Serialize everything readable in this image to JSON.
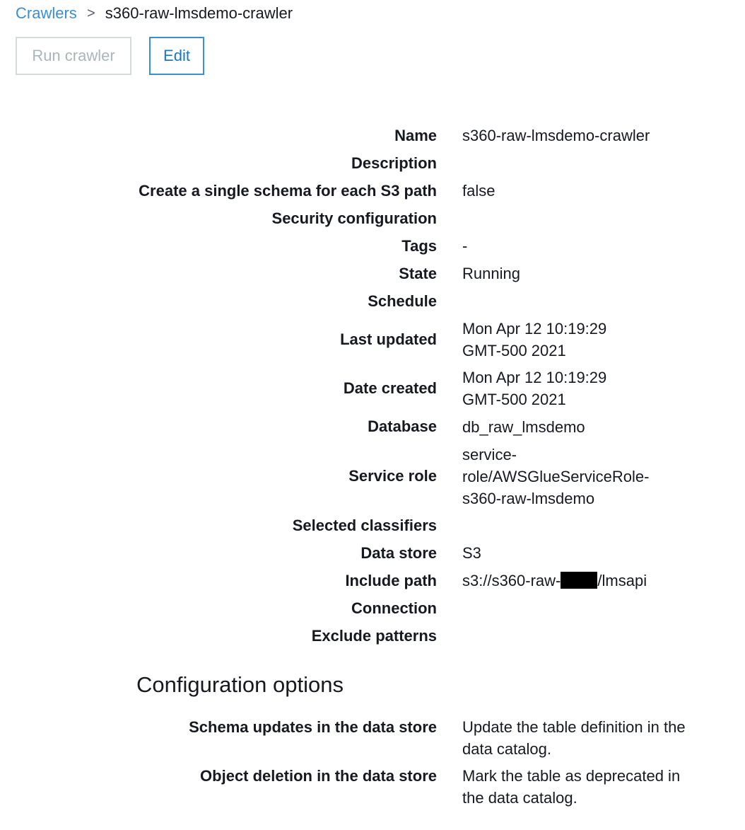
{
  "breadcrumb": {
    "parent": "Crawlers",
    "separator": ">",
    "current": "s360-raw-lmsdemo-crawler"
  },
  "toolbar": {
    "run_label": "Run crawler",
    "edit_label": "Edit"
  },
  "details": [
    {
      "label": "Name",
      "value": "s360-raw-lmsdemo-crawler"
    },
    {
      "label": "Description",
      "value": ""
    },
    {
      "label": "Create a single schema for each S3 path",
      "value": "false"
    },
    {
      "label": "Security configuration",
      "value": ""
    },
    {
      "label": "Tags",
      "value": "-"
    },
    {
      "label": "State",
      "value": "Running"
    },
    {
      "label": "Schedule",
      "value": ""
    },
    {
      "label": "Last updated",
      "value": "Mon Apr 12 10:19:29 GMT-500 2021"
    },
    {
      "label": "Date created",
      "value": "Mon Apr 12 10:19:29 GMT-500 2021"
    },
    {
      "label": "Database",
      "value": "db_raw_lmsdemo"
    },
    {
      "label": "Service role",
      "value": "service-role/AWSGlueServiceRole-s360-raw-lmsdemo"
    },
    {
      "label": "Selected classifiers",
      "value": ""
    },
    {
      "label": "Data store",
      "value": "S3"
    },
    {
      "label": "Include path",
      "value_prefix": "s3://s360-raw-",
      "value_suffix": "/lmsapi"
    },
    {
      "label": "Connection",
      "value": ""
    },
    {
      "label": "Exclude patterns",
      "value": ""
    }
  ],
  "config": {
    "title": "Configuration options",
    "items": [
      {
        "label": "Schema updates in the data store",
        "value": "Update the table definition in the data catalog."
      },
      {
        "label": "Object deletion in the data store",
        "value": "Mark the table as deprecated in the data catalog."
      }
    ]
  }
}
